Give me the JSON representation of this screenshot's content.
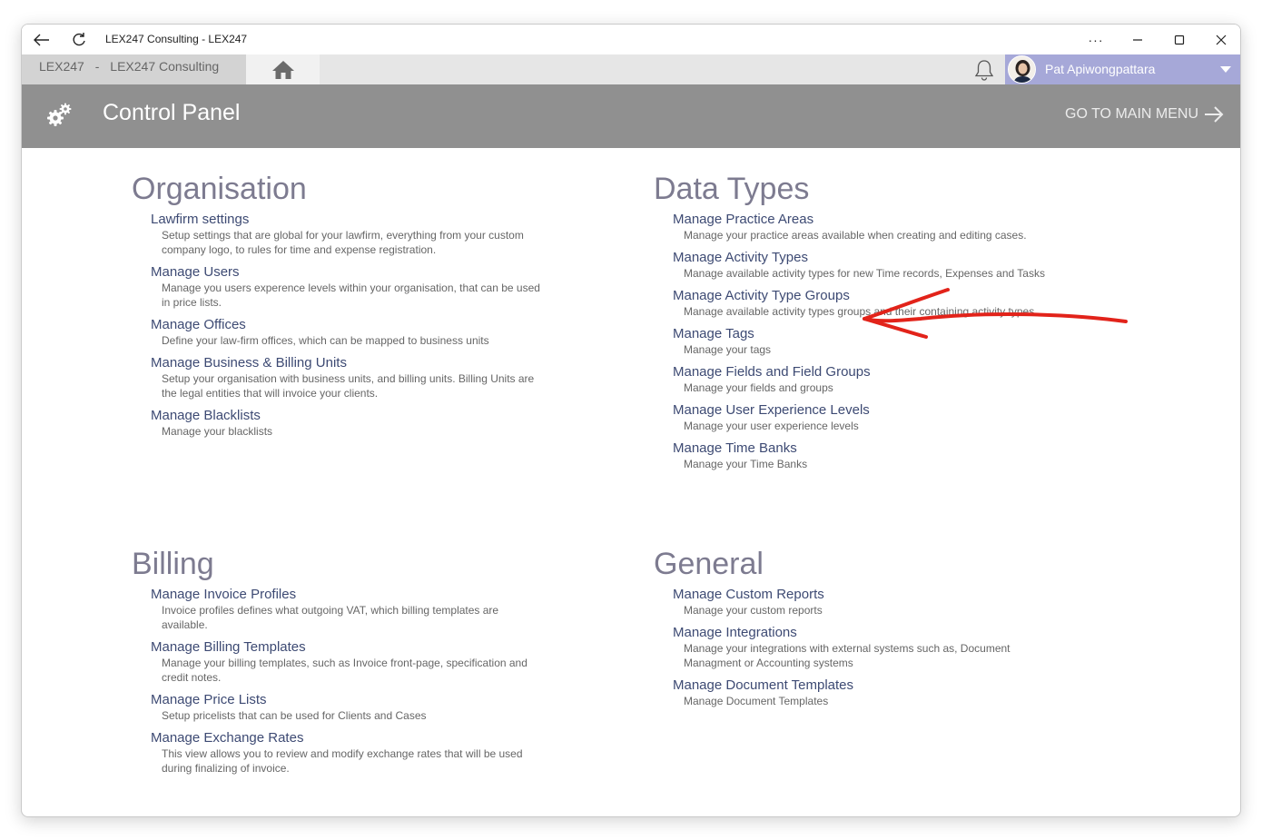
{
  "window": {
    "title": "LEX247 Consulting - LEX247",
    "controls": {
      "more": "···"
    }
  },
  "appbar": {
    "crumb_app": "LEX247",
    "crumb_sep": "-",
    "crumb_org": "LEX247 Consulting",
    "user_name": "Pat Apiwongpattara"
  },
  "header": {
    "title": "Control Panel",
    "main_menu_label": "GO TO MAIN MENU"
  },
  "sections": {
    "organisation": {
      "heading": "Organisation",
      "items": [
        {
          "title": "Lawfirm settings",
          "desc": "Setup settings that are global for your lawfirm, everything from your custom company logo, to rules for time and expense registration."
        },
        {
          "title": "Manage Users",
          "desc": "Manage you users experence levels within your organisation, that can be used in price lists."
        },
        {
          "title": "Manage Offices",
          "desc": "Define your law-firm offices, which can be mapped to business units"
        },
        {
          "title": "Manage Business & Billing Units",
          "desc": "Setup your organisation with business units, and billing units. Billing Units are the legal entities that will invoice your clients."
        },
        {
          "title": "Manage Blacklists",
          "desc": "Manage your blacklists"
        }
      ]
    },
    "data_types": {
      "heading": "Data Types",
      "items": [
        {
          "title": "Manage Practice Areas",
          "desc": "Manage your practice areas available when creating and editing cases."
        },
        {
          "title": "Manage Activity Types",
          "desc": "Manage available activity types for new Time records, Expenses and Tasks"
        },
        {
          "title": "Manage Activity Type Groups",
          "desc": "Manage available activity types groups and their containing activity types"
        },
        {
          "title": "Manage Tags",
          "desc": "Manage your tags"
        },
        {
          "title": "Manage Fields and Field Groups",
          "desc": "Manage your fields and groups"
        },
        {
          "title": "Manage User Experience Levels",
          "desc": "Manage your user experience levels"
        },
        {
          "title": "Manage Time Banks",
          "desc": "Manage your Time Banks"
        }
      ]
    },
    "billing": {
      "heading": "Billing",
      "items": [
        {
          "title": "Manage Invoice Profiles",
          "desc": "Invoice profiles defines what outgoing VAT, which billing templates are available."
        },
        {
          "title": "Manage Billing Templates",
          "desc": "Manage your billing templates, such as Invoice front-page, specification and credit notes."
        },
        {
          "title": "Manage Price Lists",
          "desc": "Setup pricelists that can be used for Clients and Cases"
        },
        {
          "title": "Manage Exchange Rates",
          "desc": "This view allows you to review and modify exchange rates that will be used during finalizing of invoice."
        }
      ]
    },
    "general": {
      "heading": "General",
      "items": [
        {
          "title": "Manage Custom Reports",
          "desc": "Manage your custom reports"
        },
        {
          "title": "Manage Integrations",
          "desc": "Manage your integrations with external systems such as, Document Managment or Accounting systems"
        },
        {
          "title": "Manage Document Templates",
          "desc": "Manage Document Templates"
        }
      ]
    }
  },
  "colors": {
    "header_bg": "#909090",
    "user_bg": "#a6a8d8",
    "link": "#3d4a73",
    "heading": "#7d7b90",
    "annotation": "#e2231a"
  },
  "icons": [
    "back-arrow-icon",
    "refresh-icon",
    "home-icon",
    "bell-icon",
    "gear-icon",
    "arrow-right-icon",
    "chevron-down-icon"
  ]
}
